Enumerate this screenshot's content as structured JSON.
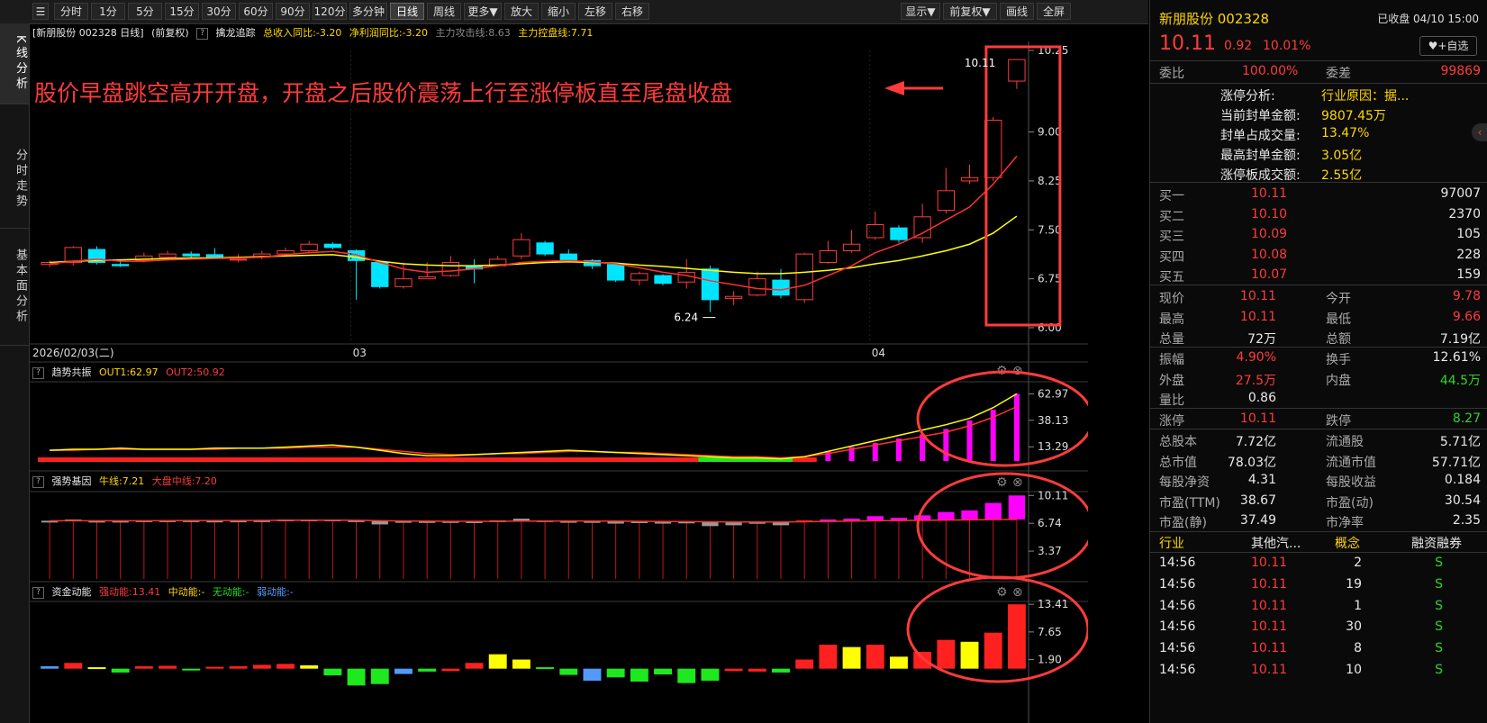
{
  "toolbar": {
    "periods": [
      "分时",
      "1分",
      "5分",
      "15分",
      "30分",
      "60分",
      "90分",
      "120分",
      "多分钟",
      "日线",
      "周线",
      "更多▼",
      "放大",
      "缩小",
      "左移",
      "右移"
    ],
    "active": "日线",
    "right_buttons": [
      "显示▼",
      "前复权▼",
      "画线",
      "全屏"
    ]
  },
  "side_tabs": [
    "K线分析",
    "分时走势",
    "基本面分析"
  ],
  "main_header": {
    "stock": "[新朋股份 002328 日线]",
    "adjust": "(前复权)",
    "indicator": "擒龙追踪",
    "rev": "总收入同比:-3.20",
    "profit": "净利润同比:-3.20",
    "attack": "主力攻击线:8.63",
    "control": "主力控盘线:7.71"
  },
  "annotation": "股价早盘跳空高开开盘，开盘之后股价震荡上行至涨停板直至尾盘收盘",
  "price_labels": {
    "last": "10.11",
    "low": "6.24"
  },
  "date_labels": {
    "start": "2026/02/03(二)",
    "m3": "03",
    "m4": "04"
  },
  "sub1_header": {
    "name": "趋势共振",
    "out1": "OUT1:62.97",
    "out2": "OUT2:50.92"
  },
  "sub2_header": {
    "name": "强势基因",
    "l1": "牛线:7.21",
    "l2": "大盘中线:7.20"
  },
  "sub3_header": {
    "name": "资金动能",
    "l1": "强动能:13.41",
    "l2": "中动能:-",
    "l3": "无动能:-",
    "l4": "弱动能:-"
  },
  "colors": {
    "up": "#ff3b3b",
    "down": "#00e5ff",
    "ma_fast": "#ff3030",
    "ma_slow": "#ffff00",
    "box": "#ff3b3b",
    "magenta": "#ff00ff"
  },
  "chart_data": [
    {
      "type": "candlestick",
      "title": "新朋股份 002328 日线",
      "ylim": [
        6.0,
        10.25
      ],
      "yticks": [
        "10.25",
        "9.00",
        "8.25",
        "7.50",
        "6.75",
        "6.00"
      ],
      "candles": [
        [
          6.97,
          7.0,
          7.03,
          6.93
        ],
        [
          7.0,
          7.23,
          7.25,
          6.95
        ],
        [
          7.2,
          7.0,
          7.25,
          6.97
        ],
        [
          6.97,
          6.95,
          7.05,
          6.93
        ],
        [
          7.03,
          7.1,
          7.15,
          7.0
        ],
        [
          7.08,
          7.13,
          7.18,
          7.05
        ],
        [
          7.13,
          7.1,
          7.17,
          7.07
        ],
        [
          7.12,
          7.08,
          7.22,
          7.05
        ],
        [
          7.05,
          7.05,
          7.13,
          7.0
        ],
        [
          7.08,
          7.13,
          7.18,
          7.05
        ],
        [
          7.13,
          7.18,
          7.23,
          7.1
        ],
        [
          7.18,
          7.28,
          7.33,
          7.15
        ],
        [
          7.28,
          7.23,
          7.31,
          7.2
        ],
        [
          7.18,
          7.03,
          7.2,
          6.43
        ],
        [
          7.0,
          6.63,
          7.03,
          6.6
        ],
        [
          6.63,
          6.75,
          7.0,
          6.6
        ],
        [
          6.75,
          6.78,
          7.0,
          6.75
        ],
        [
          6.8,
          7.0,
          7.1,
          6.78
        ],
        [
          6.95,
          6.9,
          7.05,
          6.68
        ],
        [
          6.95,
          7.05,
          7.1,
          6.95
        ],
        [
          7.1,
          7.35,
          7.45,
          7.05
        ],
        [
          7.3,
          7.13,
          7.33,
          7.1
        ],
        [
          7.13,
          7.03,
          7.2,
          7.0
        ],
        [
          7.03,
          6.95,
          7.05,
          6.9
        ],
        [
          6.97,
          6.73,
          7.0,
          6.7
        ],
        [
          6.73,
          6.83,
          6.86,
          6.65
        ],
        [
          6.8,
          6.68,
          6.82,
          6.65
        ],
        [
          6.7,
          6.85,
          7.05,
          6.6
        ],
        [
          6.9,
          6.43,
          6.95,
          6.24
        ],
        [
          6.45,
          6.48,
          6.56,
          6.35
        ],
        [
          6.5,
          6.75,
          6.86,
          6.48
        ],
        [
          6.73,
          6.5,
          6.9,
          6.45
        ],
        [
          6.43,
          7.13,
          7.15,
          6.38
        ],
        [
          7.0,
          7.18,
          7.33,
          6.98
        ],
        [
          7.18,
          7.28,
          7.5,
          7.15
        ],
        [
          7.38,
          7.58,
          7.78,
          7.35
        ],
        [
          7.53,
          7.35,
          7.57,
          7.3
        ],
        [
          7.38,
          7.7,
          7.9,
          7.3
        ],
        [
          7.8,
          8.1,
          8.45,
          7.75
        ],
        [
          8.25,
          8.3,
          8.5,
          8.2
        ],
        [
          8.3,
          9.18,
          9.23,
          8.25
        ],
        [
          9.78,
          10.11,
          10.11,
          9.66
        ]
      ],
      "ma_fast": [
        6.98,
        7.02,
        7.05,
        7.02,
        7.02,
        7.04,
        7.05,
        7.06,
        7.07,
        7.08,
        7.12,
        7.15,
        7.17,
        7.12,
        7.0,
        6.9,
        6.85,
        6.87,
        6.9,
        6.95,
        7.0,
        7.02,
        7.03,
        7.01,
        6.98,
        6.92,
        6.85,
        6.8,
        6.72,
        6.66,
        6.6,
        6.58,
        6.65,
        6.8,
        6.95,
        7.15,
        7.28,
        7.45,
        7.65,
        7.85,
        8.2,
        8.63
      ],
      "ma_slow": [
        7.0,
        7.02,
        7.03,
        7.04,
        7.05,
        7.06,
        7.07,
        7.07,
        7.08,
        7.09,
        7.1,
        7.11,
        7.12,
        7.08,
        7.02,
        6.98,
        6.96,
        6.95,
        6.95,
        6.96,
        6.98,
        7.0,
        7.01,
        7.0,
        6.99,
        6.96,
        6.94,
        6.91,
        6.88,
        6.85,
        6.83,
        6.83,
        6.85,
        6.88,
        6.92,
        6.98,
        7.03,
        7.1,
        7.18,
        7.28,
        7.45,
        7.71
      ]
    },
    {
      "type": "bar",
      "title": "趋势共振",
      "yticks": [
        "62.97",
        "38.13",
        "13.29"
      ],
      "ylim": [
        0,
        70
      ],
      "bars": [
        6,
        6,
        6,
        6,
        6,
        6,
        6,
        6,
        6,
        6,
        6,
        8,
        10,
        9,
        7,
        6,
        6,
        6,
        6,
        6,
        6,
        6,
        6,
        6,
        6,
        6,
        6,
        6,
        6,
        6,
        6,
        6,
        6,
        9,
        13,
        17,
        21,
        25,
        30,
        38,
        48,
        62.97
      ],
      "bar_colors": [
        "red",
        "red",
        "red",
        "red",
        "red",
        "red",
        "red",
        "red",
        "red",
        "red",
        "red",
        "red",
        "red",
        "red",
        "red",
        "red",
        "red",
        "red",
        "red",
        "red",
        "red",
        "red",
        "red",
        "red",
        "red",
        "red",
        "red",
        "red",
        "green",
        "green",
        "green",
        "green",
        "red",
        "magenta",
        "magenta",
        "magenta",
        "magenta",
        "magenta",
        "magenta",
        "magenta",
        "magenta",
        "magenta"
      ],
      "out1": [
        10,
        11,
        11,
        12,
        11,
        11,
        11,
        12,
        12,
        12,
        13,
        14,
        15,
        13,
        10,
        7,
        5,
        5,
        6,
        7,
        8,
        9,
        10,
        9,
        8,
        7,
        6,
        5,
        4,
        3,
        3,
        2,
        4,
        9,
        14,
        19,
        24,
        29,
        34,
        40,
        50,
        62.97
      ],
      "out2": [
        10,
        10,
        11,
        11,
        11,
        11,
        11,
        11,
        12,
        12,
        12,
        13,
        13,
        13,
        11,
        9,
        7,
        6,
        6,
        7,
        7,
        8,
        9,
        9,
        8,
        8,
        7,
        6,
        5,
        4,
        4,
        3,
        4,
        7,
        11,
        15,
        19,
        23,
        27,
        33,
        41,
        50.92
      ]
    },
    {
      "type": "bar",
      "title": "强势基因",
      "yticks": [
        "10.11",
        "6.74",
        "3.37"
      ],
      "ylim": [
        0,
        10.25
      ],
      "bars": [
        7.0,
        7.2,
        7.0,
        6.9,
        7.1,
        7.1,
        7.1,
        7.0,
        7.0,
        7.1,
        7.2,
        7.2,
        7.2,
        7.0,
        6.6,
        6.8,
        6.8,
        7.0,
        6.9,
        7.1,
        7.3,
        7.1,
        7.0,
        6.9,
        6.7,
        6.8,
        6.7,
        6.9,
        6.4,
        6.5,
        6.7,
        6.5,
        7.1,
        7.2,
        7.3,
        7.6,
        7.4,
        7.7,
        8.1,
        8.3,
        9.2,
        10.11
      ],
      "ma": [
        7.05,
        7.05,
        7.05,
        7.05,
        7.05,
        7.06,
        7.07,
        7.07,
        7.08,
        7.09,
        7.1,
        7.11,
        7.12,
        7.1,
        7.06,
        7.02,
        7.0,
        6.98,
        6.98,
        6.98,
        7.0,
        7.01,
        7.02,
        7.01,
        7.0,
        6.98,
        6.96,
        6.95,
        6.92,
        6.9,
        6.9,
        6.9,
        6.92,
        6.96,
        7.0,
        7.05,
        7.08,
        7.1,
        7.13,
        7.16,
        7.19,
        7.21
      ]
    },
    {
      "type": "bar",
      "title": "资金动能",
      "yticks": [
        "13.41",
        "7.65",
        "1.90"
      ],
      "ylim": [
        -4,
        14
      ],
      "bars": [
        0.5,
        1.2,
        0.3,
        -0.8,
        0.5,
        0.6,
        -0.2,
        0.4,
        0.5,
        0.8,
        1.0,
        0.7,
        -1.4,
        -3.5,
        -3.2,
        -1.1,
        -0.6,
        -0.5,
        1.2,
        3.0,
        1.9,
        0.3,
        -1.3,
        -2.5,
        -1.8,
        -2.7,
        -1.2,
        -3.0,
        -2.5,
        -0.5,
        -0.6,
        -0.8,
        1.9,
        5.0,
        4.5,
        5.0,
        2.5,
        3.5,
        6.0,
        5.6,
        7.5,
        13.41
      ],
      "bar_colors": [
        "blue",
        "red",
        "yellow",
        "green",
        "red",
        "red",
        "green",
        "red",
        "red",
        "red",
        "red",
        "yellow",
        "green",
        "green",
        "green",
        "blue",
        "green",
        "red",
        "red",
        "yellow",
        "yellow",
        "green",
        "green",
        "blue",
        "green",
        "green",
        "green",
        "green",
        "green",
        "red",
        "red",
        "green",
        "red",
        "red",
        "yellow",
        "red",
        "yellow",
        "red",
        "red",
        "yellow",
        "red",
        "red"
      ]
    }
  ],
  "quote": {
    "name": "新朋股份 002328",
    "status": "已收盘 04/10 15:00",
    "price": "10.11",
    "change": "0.92",
    "pct": "10.01%",
    "fav": "+自选",
    "weibi_label": "委比",
    "weibi": "100.00%",
    "weicha_label": "委差",
    "weicha": "99869",
    "limit": [
      {
        "k": "涨停分析:",
        "v": "行业原因：据..."
      },
      {
        "k": "当前封单金额:",
        "v": "9807.45万"
      },
      {
        "k": "封单占成交量:",
        "v": "13.47%"
      },
      {
        "k": "最高封单金额:",
        "v": "3.05亿"
      },
      {
        "k": "涨停板成交额:",
        "v": "2.55亿"
      }
    ],
    "bids": [
      {
        "k": "买一",
        "p": "10.11",
        "v": "97007"
      },
      {
        "k": "买二",
        "p": "10.10",
        "v": "2370"
      },
      {
        "k": "买三",
        "p": "10.09",
        "v": "105"
      },
      {
        "k": "买四",
        "p": "10.08",
        "v": "228"
      },
      {
        "k": "买五",
        "p": "10.07",
        "v": "159"
      }
    ],
    "stats1": [
      {
        "k1": "现价",
        "v1": "10.11",
        "c1": "red",
        "k2": "今开",
        "v2": "9.78",
        "c2": "red"
      },
      {
        "k1": "最高",
        "v1": "10.11",
        "c1": "red",
        "k2": "最低",
        "v2": "9.66",
        "c2": "red"
      },
      {
        "k1": "总量",
        "v1": "72万",
        "c1": "white",
        "k2": "总额",
        "v2": "7.19亿",
        "c2": "white"
      }
    ],
    "stats2": [
      {
        "k1": "振幅",
        "v1": "4.90%",
        "c1": "red",
        "k2": "换手",
        "v2": "12.61%",
        "c2": "white"
      },
      {
        "k1": "外盘",
        "v1": "27.5万",
        "c1": "red",
        "k2": "内盘",
        "v2": "44.5万",
        "c2": "green"
      },
      {
        "k1": "量比",
        "v1": "0.86",
        "c1": "white",
        "k2": "",
        "v2": "",
        "c2": "white"
      }
    ],
    "stats3": [
      {
        "k1": "涨停",
        "v1": "10.11",
        "c1": "red",
        "k2": "跌停",
        "v2": "8.27",
        "c2": "green"
      }
    ],
    "stats4": [
      {
        "k1": "总股本",
        "v1": "7.72亿",
        "k2": "流通股",
        "v2": "5.71亿"
      },
      {
        "k1": "总市值",
        "v1": "78.03亿",
        "k2": "流通市值",
        "v2": "57.71亿"
      },
      {
        "k1": "每股净资",
        "v1": "4.31",
        "k2": "每股收益",
        "v2": "0.184"
      },
      {
        "k1": "市盈(TTM)",
        "v1": "38.67",
        "k2": "市盈(动)",
        "v2": "30.54"
      },
      {
        "k1": "市盈(静)",
        "v1": "37.49",
        "k2": "市净率",
        "v2": "2.35"
      }
    ],
    "tabs": [
      "行业",
      "其他汽...",
      "概念",
      "融资融券"
    ],
    "trades": [
      {
        "t": "14:56",
        "p": "10.11",
        "v": "2",
        "s": "S"
      },
      {
        "t": "14:56",
        "p": "10.11",
        "v": "19",
        "s": "S"
      },
      {
        "t": "14:56",
        "p": "10.11",
        "v": "1",
        "s": "S"
      },
      {
        "t": "14:56",
        "p": "10.11",
        "v": "30",
        "s": "S"
      },
      {
        "t": "14:56",
        "p": "10.11",
        "v": "8",
        "s": "S"
      },
      {
        "t": "14:56",
        "p": "10.11",
        "v": "10",
        "s": "S"
      }
    ]
  }
}
